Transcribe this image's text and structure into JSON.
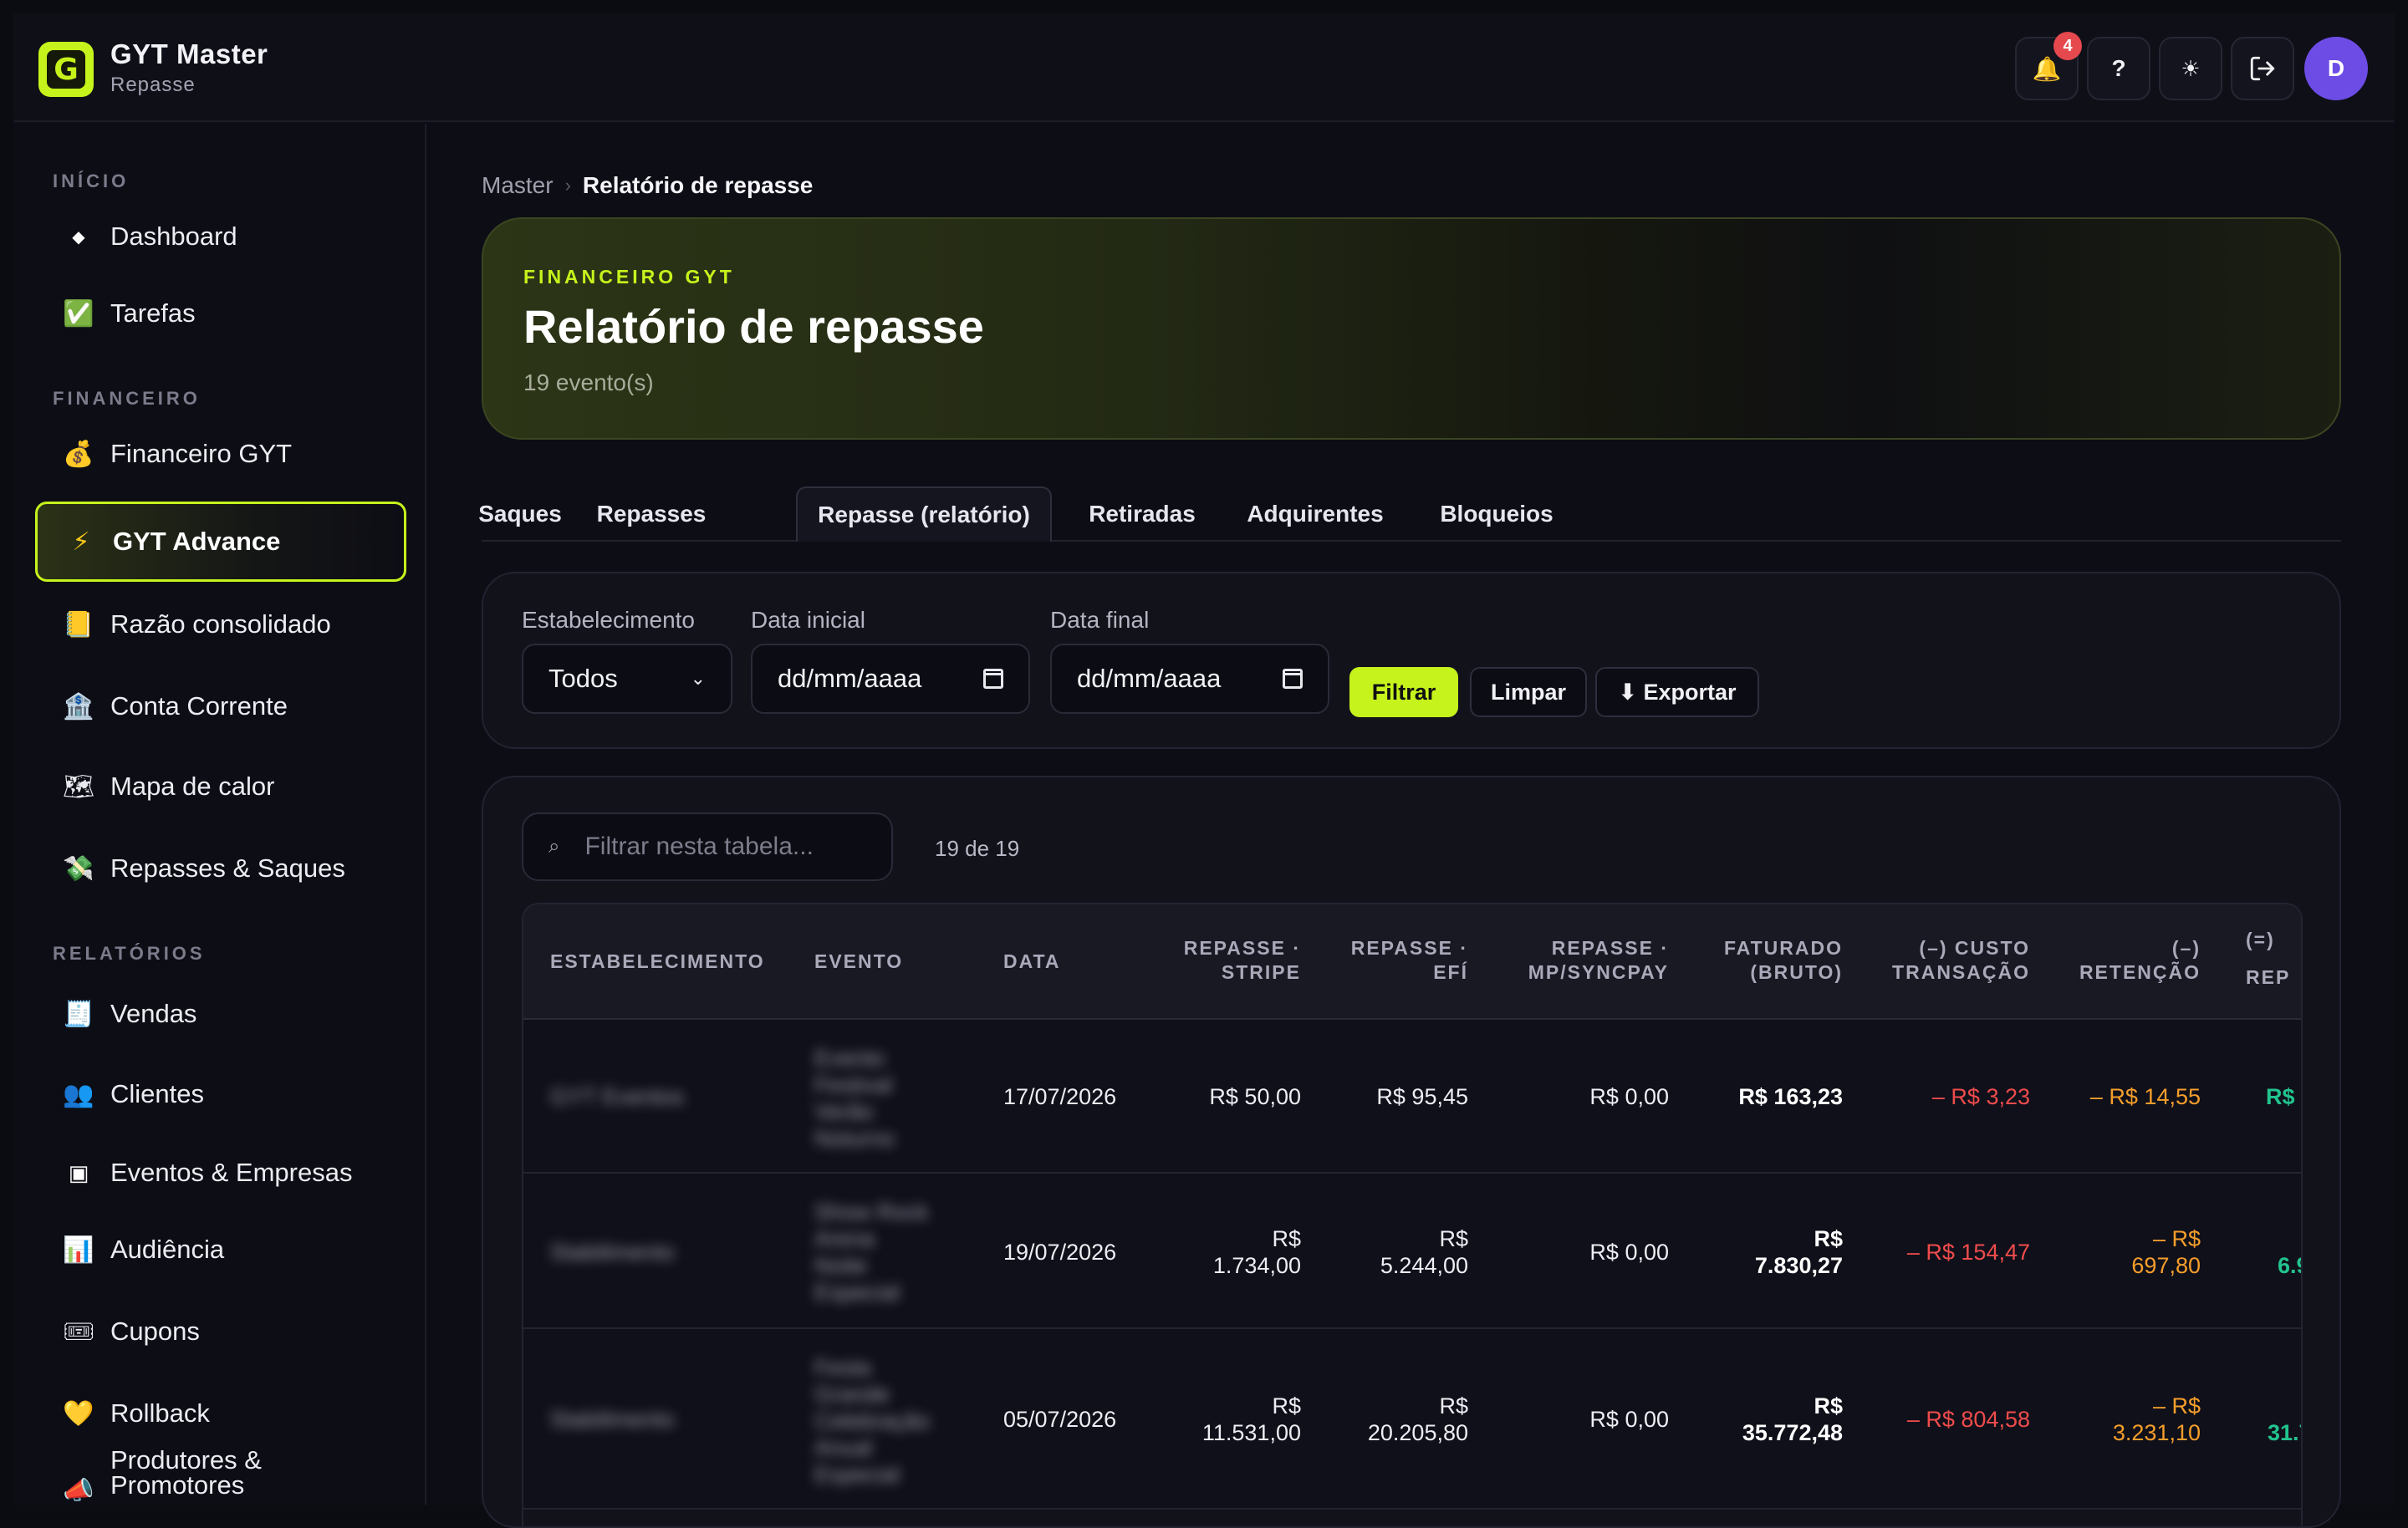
{
  "brand": {
    "logo_letter": "G",
    "title": "GYT Master",
    "subtitle": "Repasse"
  },
  "topbar": {
    "notifications_count": "4",
    "help_label": "?",
    "avatar_initial": "D"
  },
  "sidebar": {
    "sections": [
      {
        "title": "INÍCIO"
      },
      {
        "title": "FINANCEIRO"
      },
      {
        "title": "RELATÓRIOS"
      }
    ],
    "items": [
      {
        "label": "Dashboard",
        "icon": "diamond-icon",
        "glyph": "◆"
      },
      {
        "label": "Tarefas",
        "icon": "check-icon",
        "glyph": "✅"
      },
      {
        "label": "Financeiro GYT",
        "icon": "money-bag-icon",
        "glyph": "💰"
      },
      {
        "label": "GYT Advance",
        "icon": "lightning-icon",
        "glyph": "⚡",
        "active": true
      },
      {
        "label": "Razão consolidado",
        "icon": "ledger-icon",
        "glyph": "📒"
      },
      {
        "label": "Conta Corrente",
        "icon": "bank-icon",
        "glyph": "🏦"
      },
      {
        "label": "Mapa de calor",
        "icon": "map-icon",
        "glyph": "🗺"
      },
      {
        "label": "Repasses & Saques",
        "icon": "money-wings-icon",
        "glyph": "💸"
      },
      {
        "label": "Vendas",
        "icon": "receipt-icon",
        "glyph": "🧾"
      },
      {
        "label": "Clientes",
        "icon": "users-icon",
        "glyph": "👥"
      },
      {
        "label": "Eventos & Empresas",
        "icon": "square-icon",
        "glyph": "▣"
      },
      {
        "label": "Audiência",
        "icon": "chart-icon",
        "glyph": "📊"
      },
      {
        "label": "Cupons",
        "icon": "ticket-icon",
        "glyph": "🎟"
      },
      {
        "label": "Rollback",
        "icon": "heart-icon",
        "glyph": "💛"
      },
      {
        "label": "Produtores & Promotores",
        "icon": "megaphone-icon",
        "glyph": "📣"
      }
    ]
  },
  "breadcrumb": {
    "parent": "Master",
    "current": "Relatório de repasse"
  },
  "hero": {
    "kicker": "FINANCEIRO GYT",
    "title": "Relatório de repasse",
    "subtitle": "19 evento(s)"
  },
  "tabs": [
    {
      "label": "Saques"
    },
    {
      "label": "Repasses"
    },
    {
      "label": "Repasse (relatório)",
      "active": true
    },
    {
      "label": "Retiradas"
    },
    {
      "label": "Adquirentes"
    },
    {
      "label": "Bloqueios"
    }
  ],
  "filters": {
    "establishment_label": "Estabelecimento",
    "establishment_value": "Todos",
    "start_label": "Data inicial",
    "start_value": "dd/mm/aaaa",
    "end_label": "Data final",
    "end_value": "dd/mm/aaaa",
    "filter_button": "Filtrar",
    "clear_button": "Limpar",
    "export_button": "⬇ Exportar"
  },
  "table": {
    "search_placeholder": "Filtrar nesta tabela...",
    "count": "19 de 19",
    "headers": {
      "estab": "ESTABELECIMENTO",
      "evento": "EVENTO",
      "data": "DATA",
      "stripe_1": "REPASSE ·",
      "stripe_2": "STRIPE",
      "efi_1": "REPASSE ·",
      "efi_2": "EFÍ",
      "mp_1": "REPASSE ·",
      "mp_2": "MP/SYNCPAY",
      "fat_1": "FATURADO",
      "fat_2": "(BRUTO)",
      "custo_1": "(–) CUSTO",
      "custo_2": "TRANSAÇÃO",
      "ret_1": "(–)",
      "ret_2": "RETENÇÃO",
      "rep_1": "(=)",
      "rep_2": "REP"
    },
    "rows": [
      {
        "estab": "GYT Eventos",
        "evento": "Evento Festival Verão Noturno",
        "data": "17/07/2026",
        "stripe": "R$ 50,00",
        "efi": "R$ 95,45",
        "mp": "R$ 0,00",
        "fat": "R$ 163,23",
        "custo": "– R$ 3,23",
        "ret": "– R$ 14,55",
        "rep": "R$"
      },
      {
        "estab": "Stabilimento",
        "evento": "Show Rock Arena Noite Especial",
        "data": "19/07/2026",
        "stripe_1": "R$",
        "stripe_2": "1.734,00",
        "efi_1": "R$",
        "efi_2": "5.244,00",
        "mp": "R$ 0,00",
        "fat_1": "R$",
        "fat_2": "7.830,27",
        "custo": "– R$ 154,47",
        "ret_1": "– R$",
        "ret_2": "697,80",
        "rep": "6.9"
      },
      {
        "estab": "Stabilimento",
        "evento": "Festa Grande Celebração Anual Especial",
        "data": "05/07/2026",
        "stripe_1": "R$",
        "stripe_2": "11.531,00",
        "efi_1": "R$",
        "efi_2": "20.205,80",
        "mp": "R$ 0,00",
        "fat_1": "R$",
        "fat_2": "35.772,48",
        "custo": "– R$ 804,58",
        "ret_1": "– R$",
        "ret_2": "3.231,10",
        "rep": "31.7"
      }
    ]
  },
  "colors": {
    "accent": "#c6f31c",
    "background": "#0d0d15",
    "negative_red": "#ef4c4c",
    "negative_orange": "#f59e2b",
    "positive_green": "#22c38e",
    "avatar": "#6d4ce6"
  }
}
